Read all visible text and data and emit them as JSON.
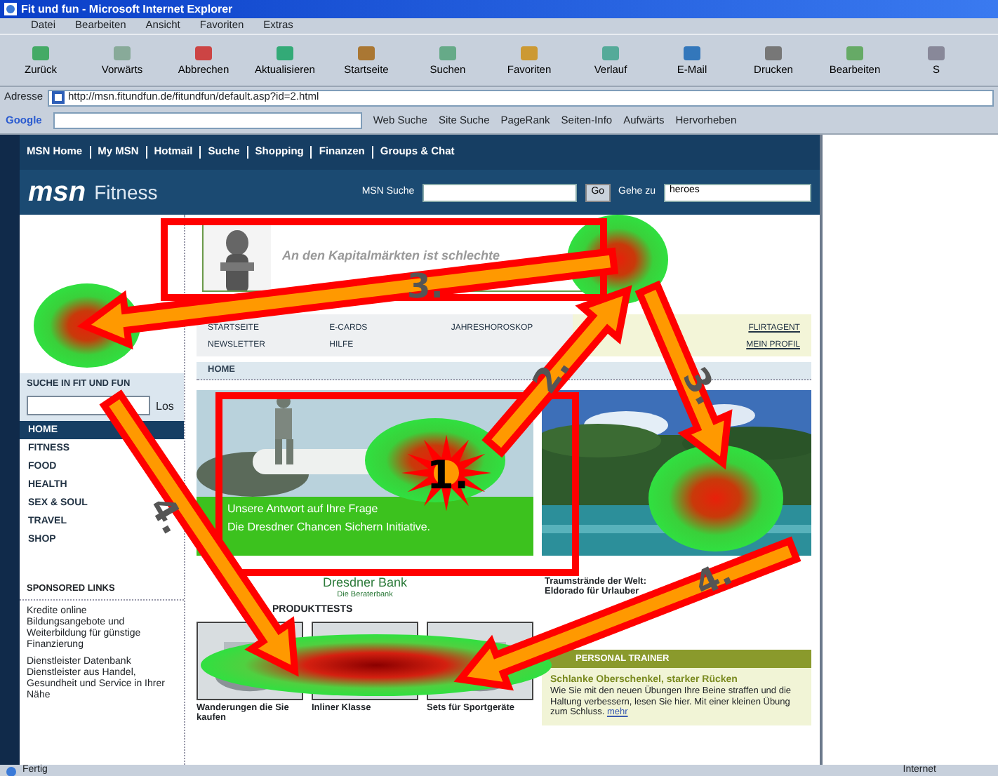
{
  "window": {
    "title": "Fit und fun - Microsoft Internet Explorer"
  },
  "menu": [
    "Datei",
    "Bearbeiten",
    "Ansicht",
    "Favoriten",
    "Extras"
  ],
  "toolbar": [
    "Zurück",
    "Vorwärts",
    "Abbrechen",
    "Aktualisieren",
    "Startseite",
    "Suchen",
    "Favoriten",
    "Verlauf",
    "E-Mail",
    "Drucken",
    "Bearbeiten",
    "S"
  ],
  "address": {
    "label": "Adresse",
    "value": "http://msn.fitundfun.de/fitundfun/default.asp?id=2.html"
  },
  "google_bar": {
    "logo": "Google",
    "buttons": [
      "Web Suche",
      "Site Suche",
      "PageRank",
      "Seiten-Info",
      "Aufwärts",
      "Hervorheben"
    ]
  },
  "site": {
    "top_nav": [
      "MSN Home",
      "My MSN",
      "Hotmail",
      "Suche",
      "Shopping",
      "Finanzen",
      "Groups & Chat"
    ],
    "brand": "msn",
    "section": "Fitness",
    "search_label": "MSN Suche",
    "go": "Go",
    "goto_label": "Gehe zu",
    "goto_value": "heroes",
    "banner": "An den Kapitalmärkten ist schlechte",
    "quick_links": [
      [
        "STARTSEITE",
        "E-CARDS",
        "JAHRESHOROSKOP",
        "FLIRTAGENT"
      ],
      [
        "NEWSLETTER",
        "HILFE",
        "MEIN PROFIL"
      ]
    ],
    "sidebar": {
      "search_title": "SUCHE IN FIT UND FUN",
      "search_go": "Los",
      "items": [
        {
          "label": "HOME",
          "selected": true
        },
        {
          "label": "FITNESS",
          "selected": false
        },
        {
          "label": "FOOD",
          "selected": false
        },
        {
          "label": "HEALTH",
          "selected": false
        },
        {
          "label": "SEX & SOUL",
          "selected": false
        },
        {
          "label": "TRAVEL",
          "selected": false
        },
        {
          "label": "SHOP",
          "selected": false
        }
      ],
      "links_title": "SPONSORED LINKS",
      "links": [
        {
          "title": "Kredite online",
          "text": "Bildungsangebote und Weiterbildung für günstige Finanzierung"
        },
        {
          "title": "Dienstleister Datenbank",
          "text": "Dienstleister aus Handel, Gesundheit und Service in Ihrer Nähe"
        }
      ]
    },
    "section_title": "HOME",
    "ad": {
      "line1": "Unsere Antwort auf Ihre Frage",
      "line2": "Die Dresdner Chancen Sichern Initiative.",
      "bank": "Dresdner Bank",
      "slogan": "Die Beraterbank"
    },
    "teaser_caption": [
      "Traumstrände der Welt:",
      "Eldorado für Urlauber"
    ],
    "products_title": "PRODUKTTESTS",
    "products": [
      {
        "caption": "Wanderungen die Sie kaufen"
      },
      {
        "caption": "Inliner Klasse"
      },
      {
        "caption": "Sets für Sportgeräte"
      }
    ],
    "trainer": {
      "title": "PERSONAL TRAINER",
      "headline": "Schlanke Oberschenkel, starker Rücken",
      "text": "Wie Sie mit den neuen Übungen Ihre Beine straffen und die Haltung verbessern, lesen Sie hier. Mit einer kleinen Übung zum Schluss.",
      "more": "mehr"
    }
  },
  "annotations": [
    {
      "kind": "star",
      "label": "1."
    },
    {
      "kind": "arrow",
      "label": "2."
    },
    {
      "kind": "arrow",
      "label": "3."
    },
    {
      "kind": "arrow",
      "label": "3."
    },
    {
      "kind": "arrow",
      "label": "4."
    },
    {
      "kind": "arrow",
      "label": "4."
    }
  ],
  "status_bar": {
    "text": "Fertig",
    "zone": "Internet"
  }
}
